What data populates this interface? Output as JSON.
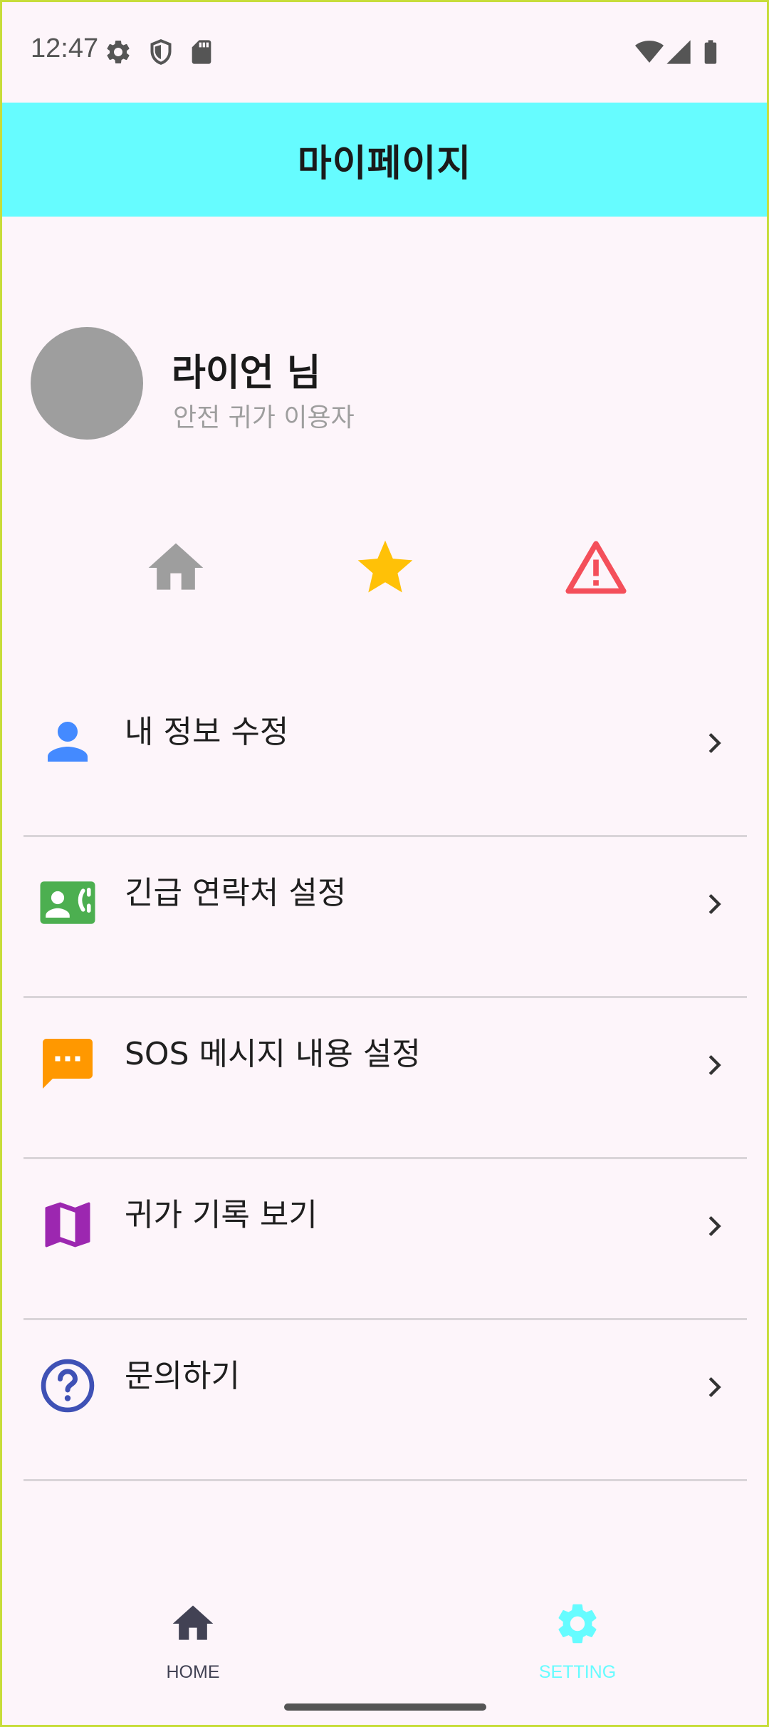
{
  "status_bar": {
    "time": "12:47",
    "left_icons": [
      "gear-icon",
      "shield-icon",
      "sdcard-icon"
    ],
    "right_icons": [
      "wifi-icon",
      "signal-icon",
      "battery-icon"
    ]
  },
  "app_bar": {
    "title": "마이페이지",
    "color": "#66fcff"
  },
  "profile": {
    "name": "라이언 님",
    "subtitle": "안전 귀가 이용자"
  },
  "quick_actions": [
    {
      "icon": "home-icon",
      "color": "#9e9e9e"
    },
    {
      "icon": "star-icon",
      "color": "#ffc107"
    },
    {
      "icon": "warning-icon",
      "color": "#f44f5a"
    }
  ],
  "menu": [
    {
      "label": "내 정보 수정",
      "icon": "person-icon",
      "color": "#448aff"
    },
    {
      "label": "긴급 연락처 설정",
      "icon": "contact-phone-icon",
      "color": "#4caf50"
    },
    {
      "label": "SOS 메시지 내용 설정",
      "icon": "sms-icon",
      "color": "#ff9800"
    },
    {
      "label": "귀가 기록 보기",
      "icon": "map-icon",
      "color": "#9c27b0"
    },
    {
      "label": "문의하기",
      "icon": "help-icon",
      "color": "#3f51b5"
    }
  ],
  "bottom_nav": [
    {
      "label": "HOME",
      "icon": "home-icon",
      "color": "#424254",
      "selected": false
    },
    {
      "label": "SETTING",
      "icon": "gear-icon",
      "color": "#66fcff",
      "selected": true
    }
  ]
}
